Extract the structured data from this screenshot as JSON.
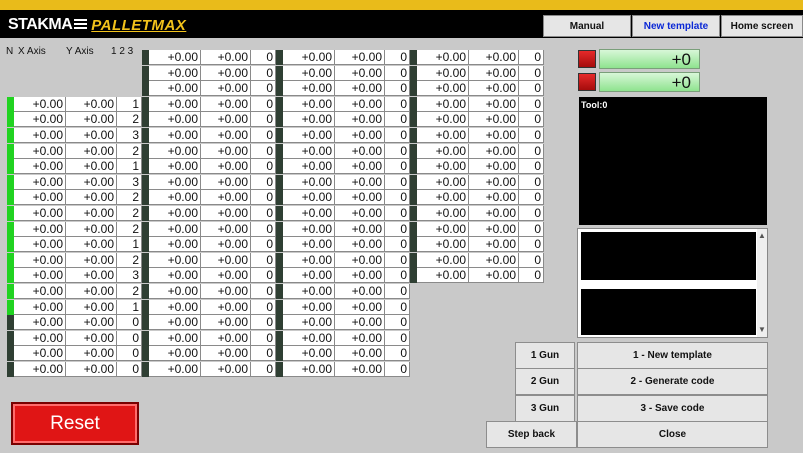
{
  "header": {
    "brand": "STAKMA",
    "product": "PALLETMAX",
    "buttons": {
      "manual": "Manual",
      "new_template": "New template",
      "home": "Home screen"
    }
  },
  "columns": {
    "n": "N",
    "x": "X Axis",
    "y": "Y Axis",
    "count": "1 2 3"
  },
  "grid": {
    "main_rows": [
      {
        "x": "+0.00",
        "y": "+0.00",
        "n": "1",
        "on": true
      },
      {
        "x": "+0.00",
        "y": "+0.00",
        "n": "2",
        "on": true
      },
      {
        "x": "+0.00",
        "y": "+0.00",
        "n": "3",
        "on": true
      },
      {
        "x": "+0.00",
        "y": "+0.00",
        "n": "2",
        "on": true
      },
      {
        "x": "+0.00",
        "y": "+0.00",
        "n": "1",
        "on": true
      },
      {
        "x": "+0.00",
        "y": "+0.00",
        "n": "3",
        "on": true
      },
      {
        "x": "+0.00",
        "y": "+0.00",
        "n": "2",
        "on": true
      },
      {
        "x": "+0.00",
        "y": "+0.00",
        "n": "2",
        "on": true
      },
      {
        "x": "+0.00",
        "y": "+0.00",
        "n": "2",
        "on": true
      },
      {
        "x": "+0.00",
        "y": "+0.00",
        "n": "1",
        "on": true
      },
      {
        "x": "+0.00",
        "y": "+0.00",
        "n": "2",
        "on": true
      },
      {
        "x": "+0.00",
        "y": "+0.00",
        "n": "3",
        "on": true
      },
      {
        "x": "+0.00",
        "y": "+0.00",
        "n": "2",
        "on": true
      },
      {
        "x": "+0.00",
        "y": "+0.00",
        "n": "1",
        "on": true
      },
      {
        "x": "+0.00",
        "y": "+0.00",
        "n": "0",
        "on": false
      },
      {
        "x": "+0.00",
        "y": "+0.00",
        "n": "0",
        "on": false
      },
      {
        "x": "+0.00",
        "y": "+0.00",
        "n": "0",
        "on": false
      },
      {
        "x": "+0.00",
        "y": "+0.00",
        "n": "0",
        "on": false
      }
    ],
    "group2_rows": 21,
    "group3_rows": 21,
    "group4_rows": 15,
    "group_values": {
      "x": "+0.00",
      "y": "+0.00",
      "n": "0"
    }
  },
  "right_panel": {
    "value1": "+0",
    "value2": "+0",
    "tool_label": "Tool:0"
  },
  "buttons": {
    "gun1": "1 Gun",
    "gun2": "2 Gun",
    "gun3": "3 Gun",
    "step_back": "Step back",
    "new_template": "1 - New template",
    "generate_code": "2 - Generate code",
    "save_code": "3 - Save code",
    "close": "Close",
    "reset": "Reset"
  }
}
